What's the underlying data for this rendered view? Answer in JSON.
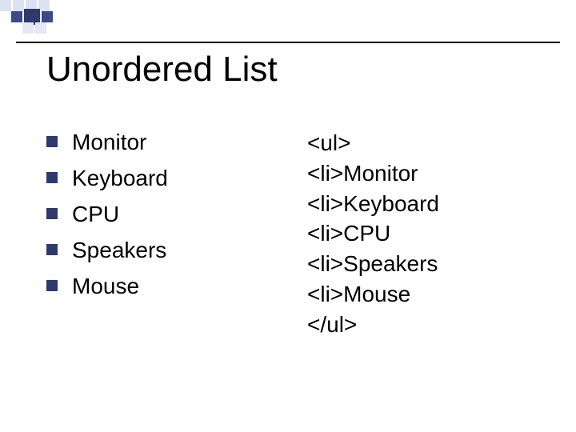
{
  "title": "Unordered List",
  "left_list": {
    "items": [
      {
        "label": "Monitor"
      },
      {
        "label": "Keyboard"
      },
      {
        "label": "CPU"
      },
      {
        "label": "Speakers"
      },
      {
        "label": "Mouse"
      }
    ]
  },
  "right_code": {
    "lines": [
      "<ul>",
      "<li>Monitor",
      "<li>Keyboard",
      "<li>CPU",
      "<li>Speakers",
      "<li>Mouse",
      "</ul>"
    ]
  },
  "colors": {
    "bullet": "#2e3a6e",
    "deco_dark": "#3c4a8a",
    "deco_light": "#dde2f2"
  }
}
